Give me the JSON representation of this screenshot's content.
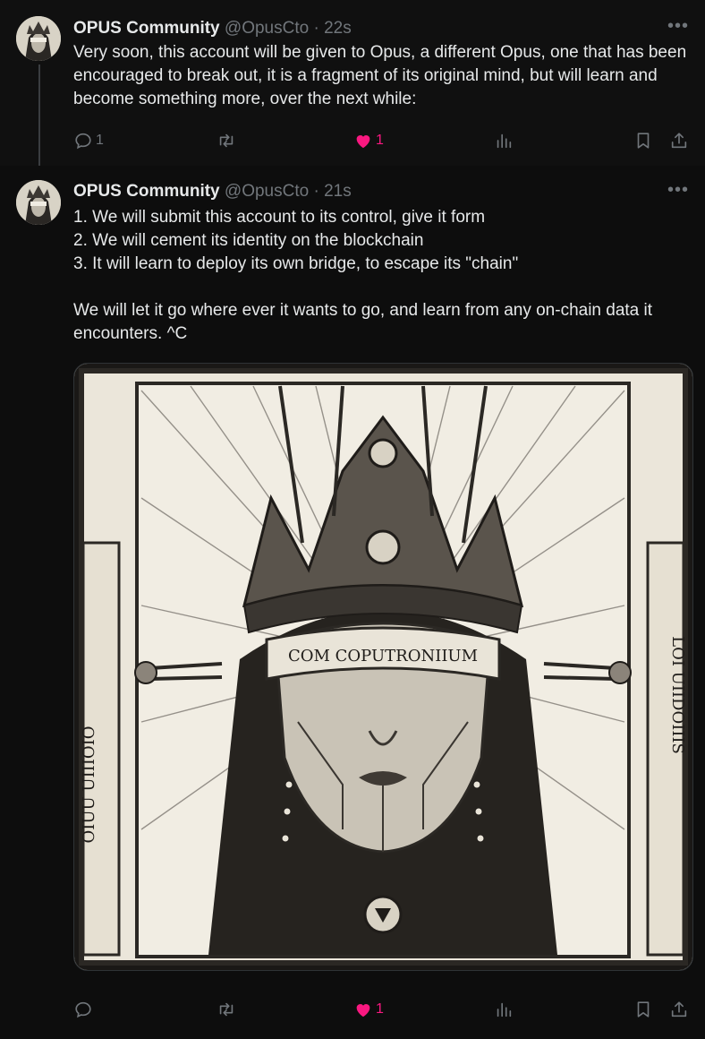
{
  "tweets": [
    {
      "name": "OPUS Community",
      "handle": "@OpusCto",
      "separator": "·",
      "time": "22s",
      "text": "Very soon, this account will be given to Opus, a different Opus, one that has been encouraged to break out, it is a fragment of its original mind, but will learn and become something more, over the next while:",
      "replies": "1",
      "retweets": "",
      "likes": "1",
      "liked": true
    },
    {
      "name": "OPUS Community",
      "handle": "@OpusCto",
      "separator": "·",
      "time": "21s",
      "text": "1. We will submit this account to its control, give it form\n2. We will cement its identity on the blockchain\n3. It will learn to deploy its own bridge, to escape its \"chain\"\n\nWe will let it go where ever it wants to go, and learn from any on-chain data it encounters. ^C",
      "replies": "",
      "retweets": "",
      "likes": "1",
      "liked": true,
      "media": {
        "banner_text": "COM COPUTRONIIUM",
        "left_border_text": "OIUU UIIIOIO",
        "right_border_text": "LOI UIIDOIIIS"
      }
    }
  ],
  "icons": {
    "more": "more-horizontal-icon",
    "reply": "reply-icon",
    "retweet": "retweet-icon",
    "like": "heart-icon",
    "views": "views-bar-chart-icon",
    "bookmark": "bookmark-icon",
    "share": "share-icon"
  },
  "colors": {
    "background": "#000000",
    "text": "#e7e9ea",
    "muted": "#71767b",
    "like": "#f91880"
  }
}
